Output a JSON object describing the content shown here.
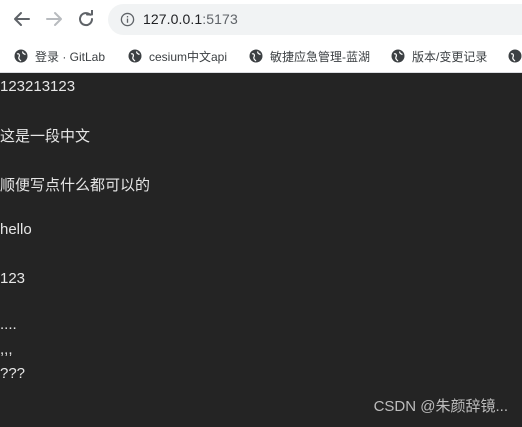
{
  "browser": {
    "url_host": "127.0.0.1",
    "url_port": ":5173",
    "bookmarks": [
      {
        "label": "登录 · GitLab",
        "icon": "globe-icon"
      },
      {
        "label": "cesium中文api",
        "icon": "globe-icon"
      },
      {
        "label": "敏捷应急管理-蓝湖",
        "icon": "globe-icon"
      },
      {
        "label": "版本/变更记录",
        "icon": "globe-icon"
      }
    ]
  },
  "page": {
    "background": "#242424",
    "lines": [
      "123213123",
      "这是一段中文",
      "顺便写点什么都可以的",
      "hello",
      "123",
      "....",
      ",,,",
      "???"
    ]
  },
  "watermark": "CSDN @朱颜辞镜..."
}
